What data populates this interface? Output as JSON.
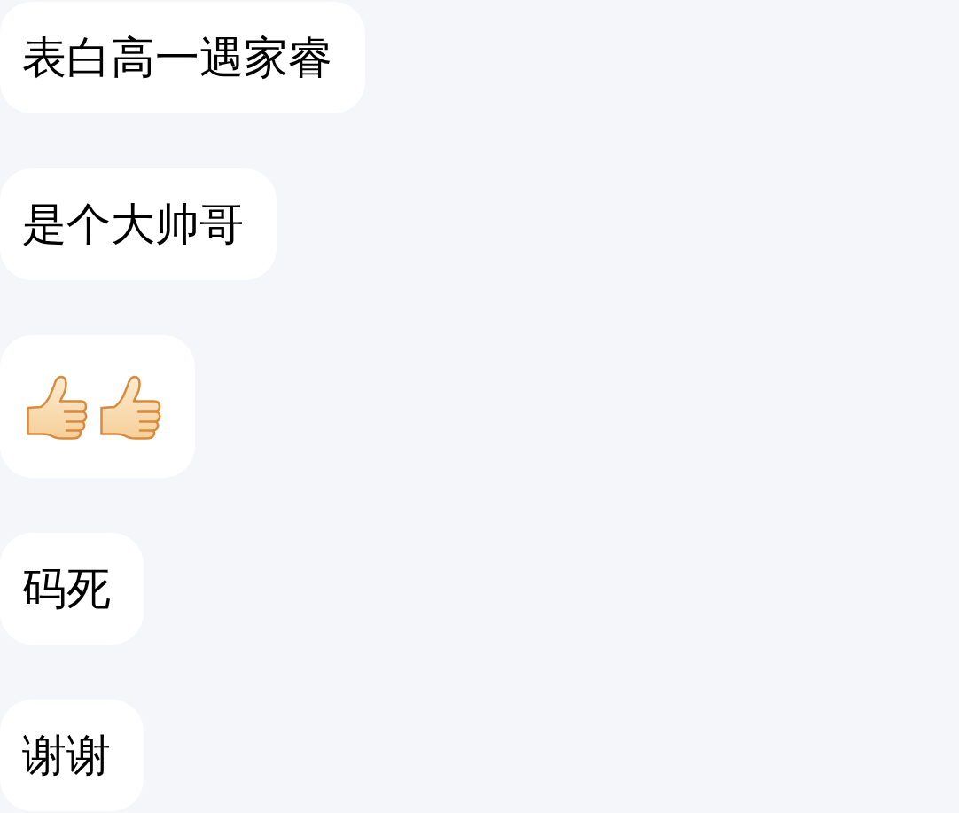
{
  "messages": [
    {
      "kind": "text",
      "text": "表白高一遇家睿"
    },
    {
      "kind": "text",
      "text": "是个大帅哥"
    },
    {
      "kind": "emoji",
      "emojis": [
        {
          "kind": "thumbs_up"
        },
        {
          "kind": "thumbs_up"
        }
      ]
    },
    {
      "kind": "text",
      "text": "码死"
    },
    {
      "kind": "text",
      "text": "谢谢"
    }
  ]
}
